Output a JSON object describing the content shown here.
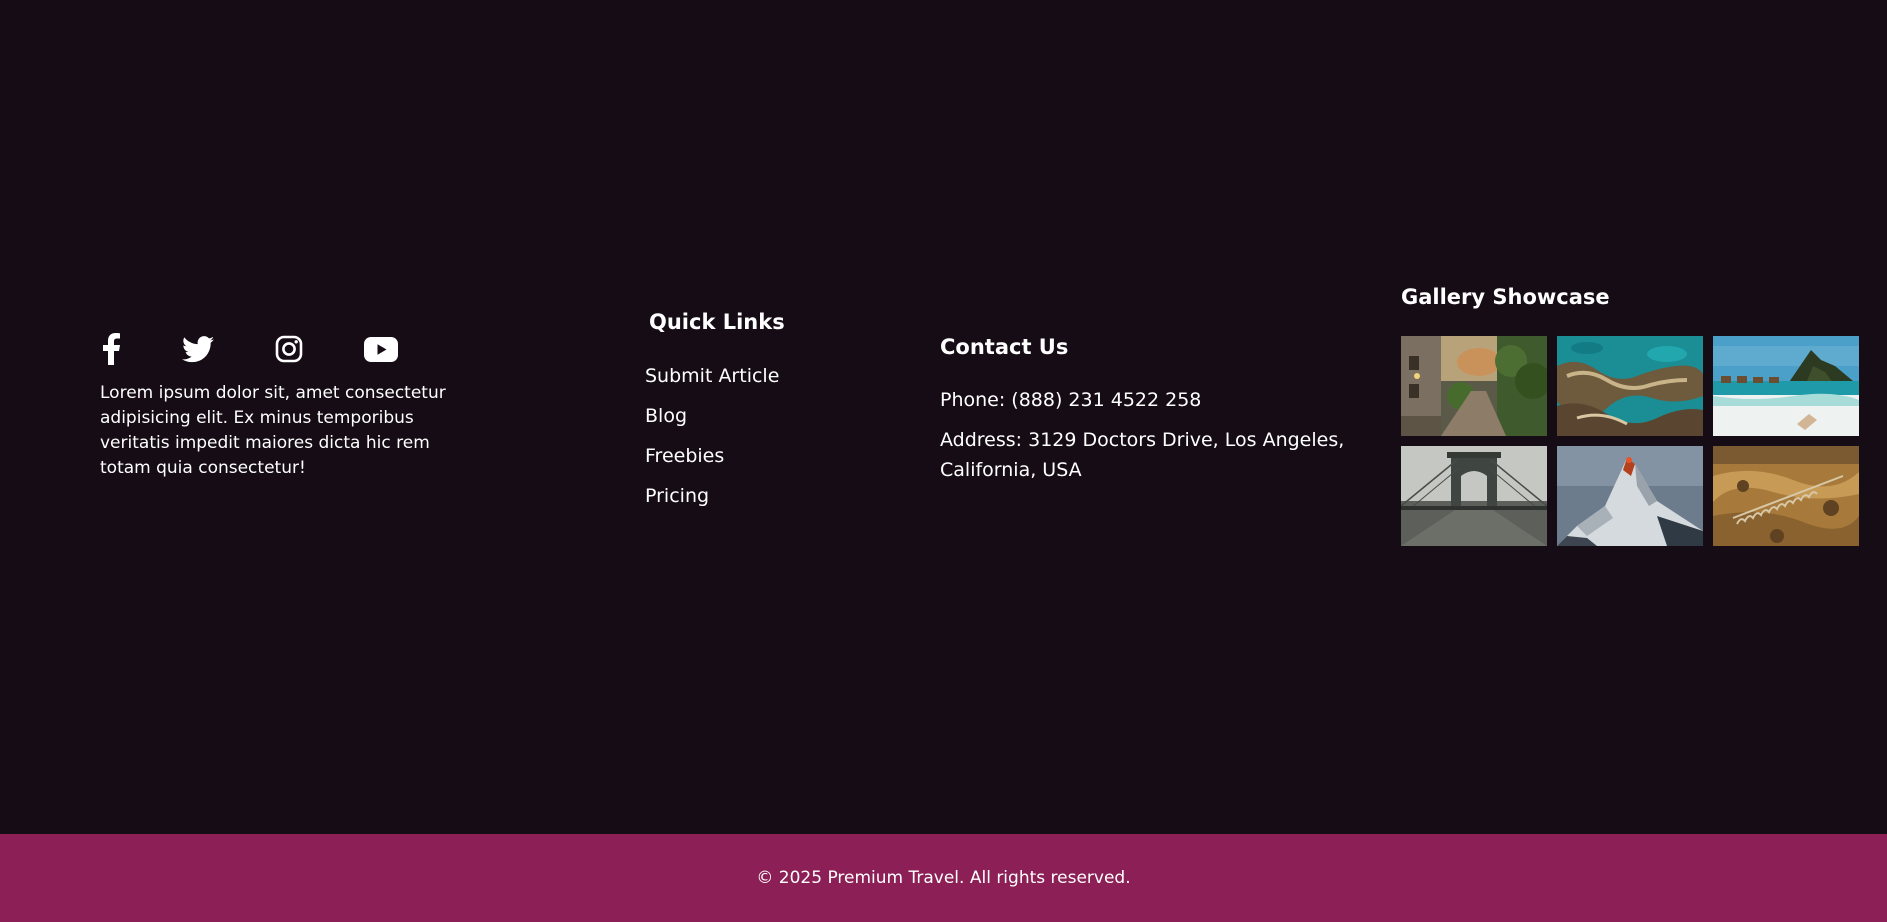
{
  "colors": {
    "background": "#150c15",
    "bottom_bar": "#8c1f56",
    "text": "#ffffff"
  },
  "about": {
    "social_icons": [
      "facebook-icon",
      "twitter-icon",
      "instagram-icon",
      "youtube-icon"
    ],
    "text": "Lorem ipsum dolor sit, amet consectetur adipisicing elit. Ex minus temporibus veritatis impedit maiores dicta hic rem totam quia consectetur!"
  },
  "quick_links": {
    "title": "Quick Links",
    "items": [
      "Submit Article",
      "Blog",
      "Freebies",
      "Pricing"
    ]
  },
  "contact": {
    "title": "Contact Us",
    "phone": "Phone: (888) 231 4522 258",
    "address": "Address: 3129 Doctors Drive, Los Angeles, California, USA"
  },
  "gallery": {
    "title": "Gallery Showcase",
    "images": [
      "street-photo",
      "coastline-photo",
      "island-beach-photo",
      "bridge-photo",
      "snowy-mountain-photo",
      "canyon-railway-photo"
    ]
  },
  "footer": {
    "copyright": "© 2025 Premium Travel. All rights reserved."
  }
}
